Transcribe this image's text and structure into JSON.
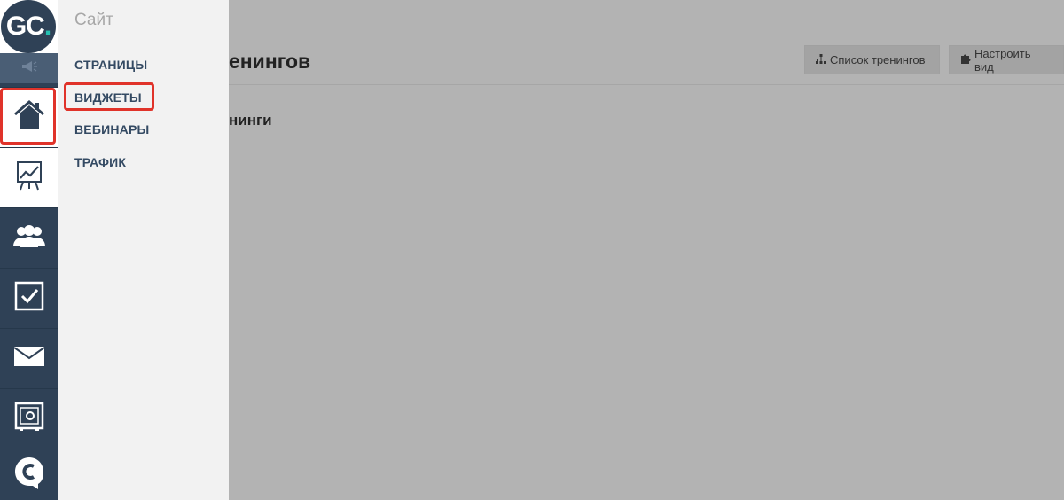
{
  "logo": {
    "text": "GC",
    "dot": "."
  },
  "submenu": {
    "title": "Сайт",
    "items": [
      {
        "label": "СТРАНИЦЫ"
      },
      {
        "label": "ВИДЖЕТЫ"
      },
      {
        "label": "ВЕБИНАРЫ"
      },
      {
        "label": "ТРАФИК"
      }
    ]
  },
  "rail": {
    "items": [
      "announcement-icon",
      "home-icon",
      "chart-board-icon",
      "users-icon",
      "checkbox-icon",
      "envelope-icon",
      "safe-icon",
      "chat-icon"
    ]
  },
  "main": {
    "heading_fragment": "енингов",
    "section_fragment": "нинги",
    "buttons": {
      "trainings_list": "Список тренингов",
      "customize_view": "Настроить вид"
    }
  },
  "colors": {
    "rail": "#2f4156",
    "accent": "#25c0b1",
    "highlight": "#e0332a",
    "overlay": "#b3b3b3"
  }
}
